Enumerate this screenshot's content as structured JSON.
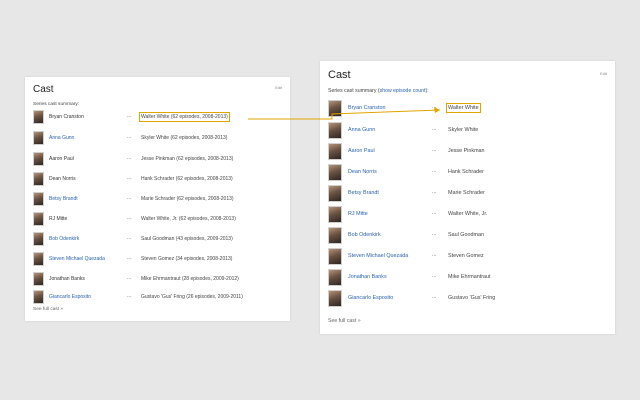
{
  "left": {
    "title": "Cast",
    "edit_label": "Edit",
    "summary_label": "Series cast summary:",
    "see_full": "See full cast »",
    "rows": [
      {
        "actor": "Bryan Cranston",
        "role": "Walter White (62 episodes, 2008-2013)"
      },
      {
        "actor": "Anna Gunn",
        "role": "Skyler White (62 episodes, 2008-2013)"
      },
      {
        "actor": "Aaron Paul",
        "role": "Jesse Pinkman (62 episodes, 2008-2013)"
      },
      {
        "actor": "Dean Norris",
        "role": "Hank Schrader (62 episodes, 2008-2013)"
      },
      {
        "actor": "Betsy Brandt",
        "role": "Marie Schrader (62 episodes, 2008-2013)"
      },
      {
        "actor": "RJ Mitte",
        "role": "Walter White, Jr. (62 episodes, 2008-2013)"
      },
      {
        "actor": "Bob Odenkirk",
        "role": "Saul Goodman (43 episodes, 2009-2013)"
      },
      {
        "actor": "Steven Michael Quezada",
        "role": "Steven Gomez (34 episodes, 2008-2013)"
      },
      {
        "actor": "Jonathan Banks",
        "role": "Mike Ehrmantraut (28 episodes, 2009-2012)"
      },
      {
        "actor": "Giancarlo Esposito",
        "role": "Gustavo 'Gus' Fring (26 episodes, 2009-2011)"
      }
    ]
  },
  "right": {
    "title": "Cast",
    "edit_label": "Edit",
    "summary_label": "Series cast summary",
    "summary_link": "show episode count",
    "see_full": "See full cast »",
    "rows": [
      {
        "actor": "Bryan Cranston",
        "role": "Walter White"
      },
      {
        "actor": "Anna Gunn",
        "role": "Skyler White"
      },
      {
        "actor": "Aaron Paul",
        "role": "Jesse Pinkman"
      },
      {
        "actor": "Dean Norris",
        "role": "Hank Schrader"
      },
      {
        "actor": "Betsy Brandt",
        "role": "Marie Schrader"
      },
      {
        "actor": "RJ Mitte",
        "role": "Walter White, Jr."
      },
      {
        "actor": "Bob Odenkirk",
        "role": "Saul Goodman"
      },
      {
        "actor": "Steven Michael Quezada",
        "role": "Steven Gomez"
      },
      {
        "actor": "Jonathan Banks",
        "role": "Mike Ehrmantraut"
      },
      {
        "actor": "Giancarlo Esposito",
        "role": "Gustavo 'Gus' Fring"
      }
    ]
  },
  "colors": {
    "link": "#2a63b0",
    "highlight": "#e0a400",
    "background": "#e7e7e7"
  }
}
